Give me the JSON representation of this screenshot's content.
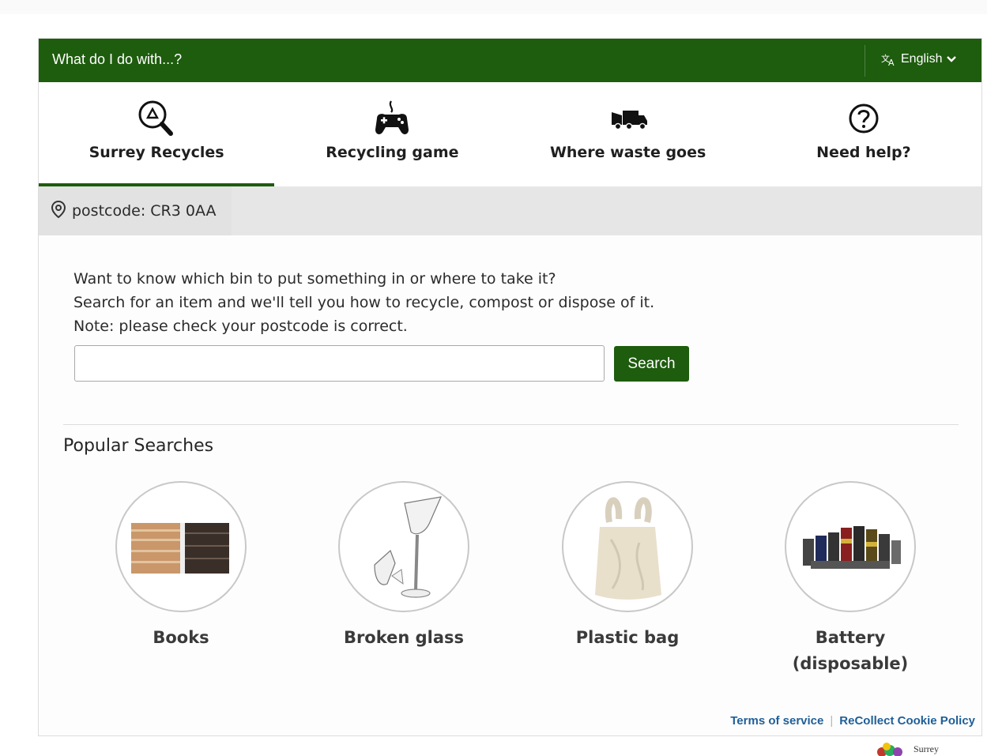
{
  "top_strip": {
    "text": ""
  },
  "header": {
    "title": "What do I do with...?",
    "language": "English"
  },
  "tabs": [
    {
      "label": "Surrey Recycles",
      "icon": "recycle-search-icon",
      "active": true
    },
    {
      "label": "Recycling game",
      "icon": "gamepad-icon",
      "active": false
    },
    {
      "label": "Where waste goes",
      "icon": "truck-icon",
      "active": false
    },
    {
      "label": "Need help?",
      "icon": "question-circle-icon",
      "active": false
    }
  ],
  "postcode": {
    "label": "postcode: CR3 0AA",
    "icon": "location-pin-icon"
  },
  "intro": {
    "line1": "Want to know which bin to put something in or where to take it?",
    "line2": "Search for an item and we'll tell you how to recycle, compost or dispose of it.",
    "line3": "Note: please check your postcode is correct."
  },
  "search": {
    "value": "",
    "placeholder": "",
    "button_label": "Search"
  },
  "popular": {
    "title": "Popular Searches",
    "items": [
      {
        "label": "Books",
        "image": "books-image"
      },
      {
        "label": "Broken glass",
        "image": "broken-glass-image"
      },
      {
        "label": "Plastic bag",
        "image": "plastic-bag-image"
      },
      {
        "label": "Battery (disposable)",
        "image": "batteries-image"
      }
    ]
  },
  "footer": {
    "terms": "Terms of service",
    "separator": "|",
    "cookie": "ReCollect Cookie Policy"
  },
  "council": {
    "name": "Surrey"
  },
  "colors": {
    "brand_green": "#1e5c0e",
    "link_blue": "#1f5f98",
    "postcode_bg": "#e6e6e6"
  }
}
